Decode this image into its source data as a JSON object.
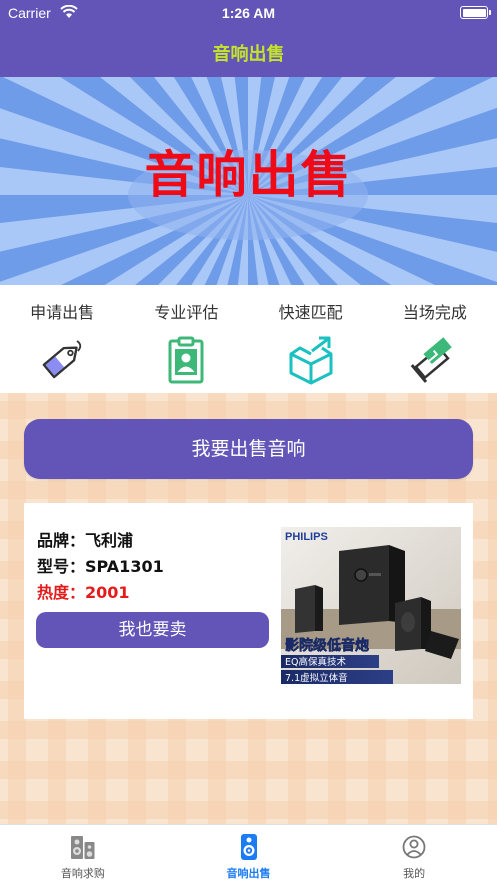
{
  "status_bar": {
    "carrier": "Carrier",
    "time": "1:26 AM"
  },
  "nav": {
    "title": "音响出售"
  },
  "banner": {
    "title": "音响出售"
  },
  "features": [
    {
      "label": "申请出售",
      "icon": "tag-icon"
    },
    {
      "label": "专业评估",
      "icon": "clipboard-user-icon"
    },
    {
      "label": "快速匹配",
      "icon": "box-icon"
    },
    {
      "label": "当场完成",
      "icon": "handshake-icon"
    }
  ],
  "sell_button": {
    "label": "我要出售音响"
  },
  "card": {
    "brand_label": "品牌：",
    "brand": "飞利浦",
    "model_label": "型号：",
    "model": "SPA1301",
    "heat_label": "热度：",
    "heat": "2001",
    "button_label": "我也要卖",
    "image": {
      "brand_text": "PHILIPS",
      "headline": "影院级低音炮",
      "line1": "EQ高保真技术",
      "line2": "7.1虚拟立体音"
    }
  },
  "tabbar": {
    "tabs": [
      {
        "label": "音响求购",
        "icon": "speaker-icon",
        "active": false
      },
      {
        "label": "音响出售",
        "icon": "speaker-sell-icon",
        "active": true
      },
      {
        "label": "我的",
        "icon": "profile-icon",
        "active": false
      }
    ]
  },
  "colors": {
    "primary": "#6354b8",
    "nav_title": "#c4e32b",
    "banner_text": "#ef0a18",
    "heat": "#e51b1b",
    "tab_active": "#1c7cf4"
  }
}
